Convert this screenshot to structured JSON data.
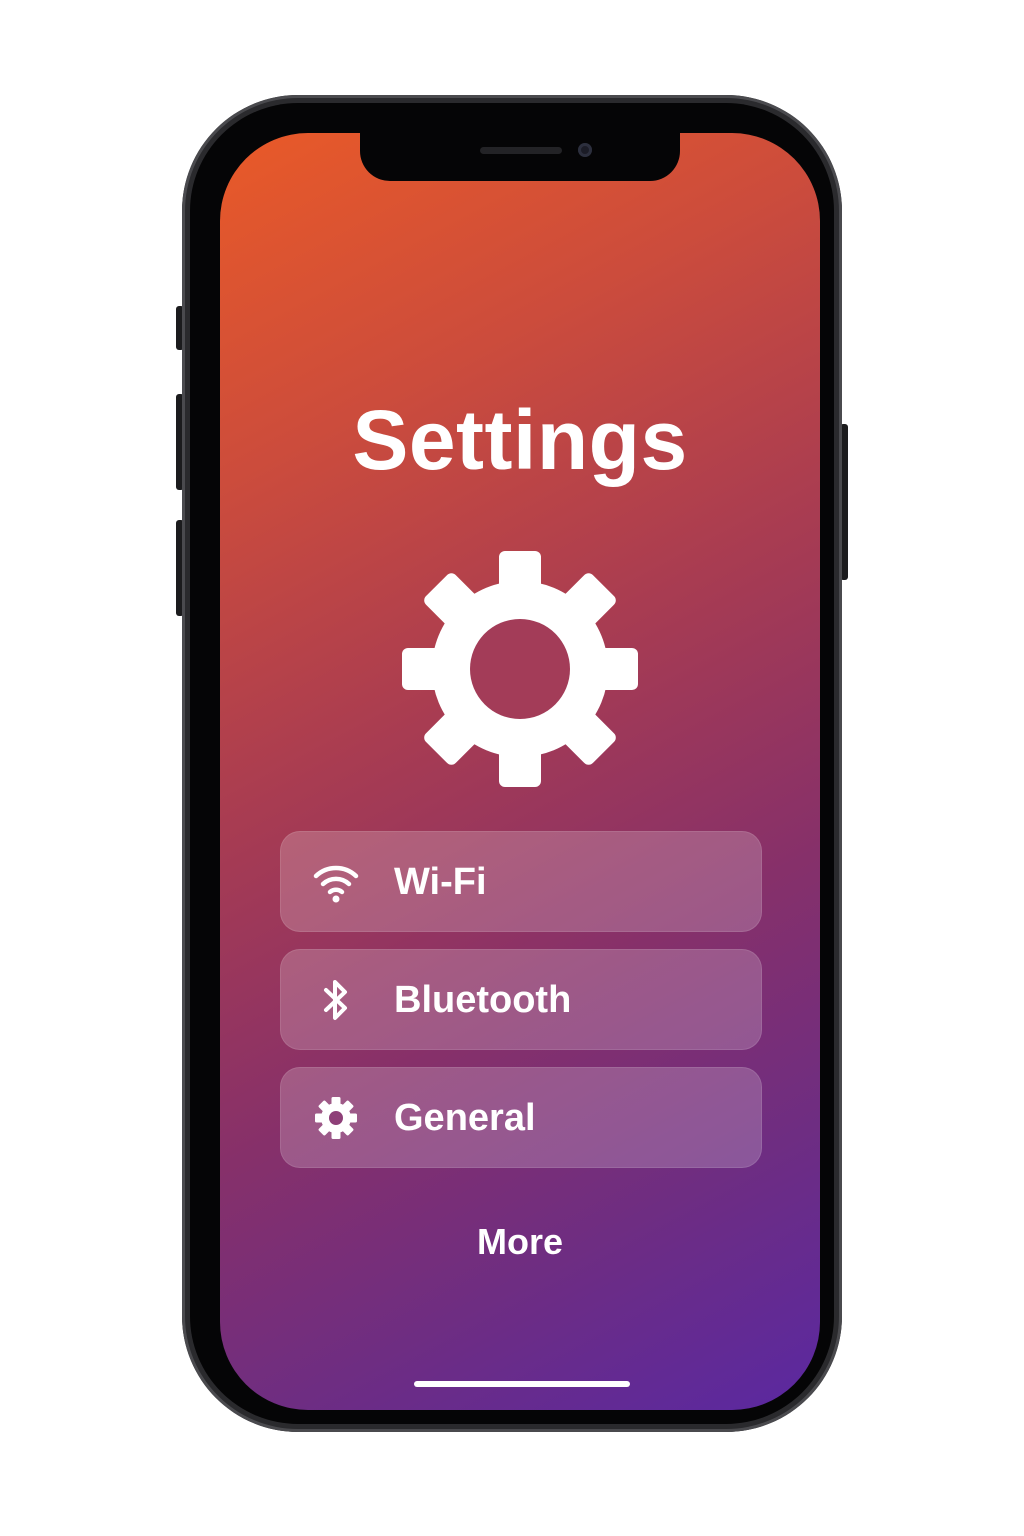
{
  "screen": {
    "title": "Settings",
    "hero_icon": "gear-icon",
    "background_gradient": [
      "#e95a28",
      "#a63b53",
      "#5a28a1"
    ]
  },
  "menu": {
    "items": [
      {
        "label": "Wi-Fi",
        "icon": "wifi-icon"
      },
      {
        "label": "Bluetooth",
        "icon": "bluetooth-icon"
      },
      {
        "label": "General",
        "icon": "gear-icon"
      }
    ]
  },
  "footer": {
    "more_label": "More"
  },
  "device": {
    "frame_color": "#050506",
    "accent_text_color": "#ffffff"
  }
}
